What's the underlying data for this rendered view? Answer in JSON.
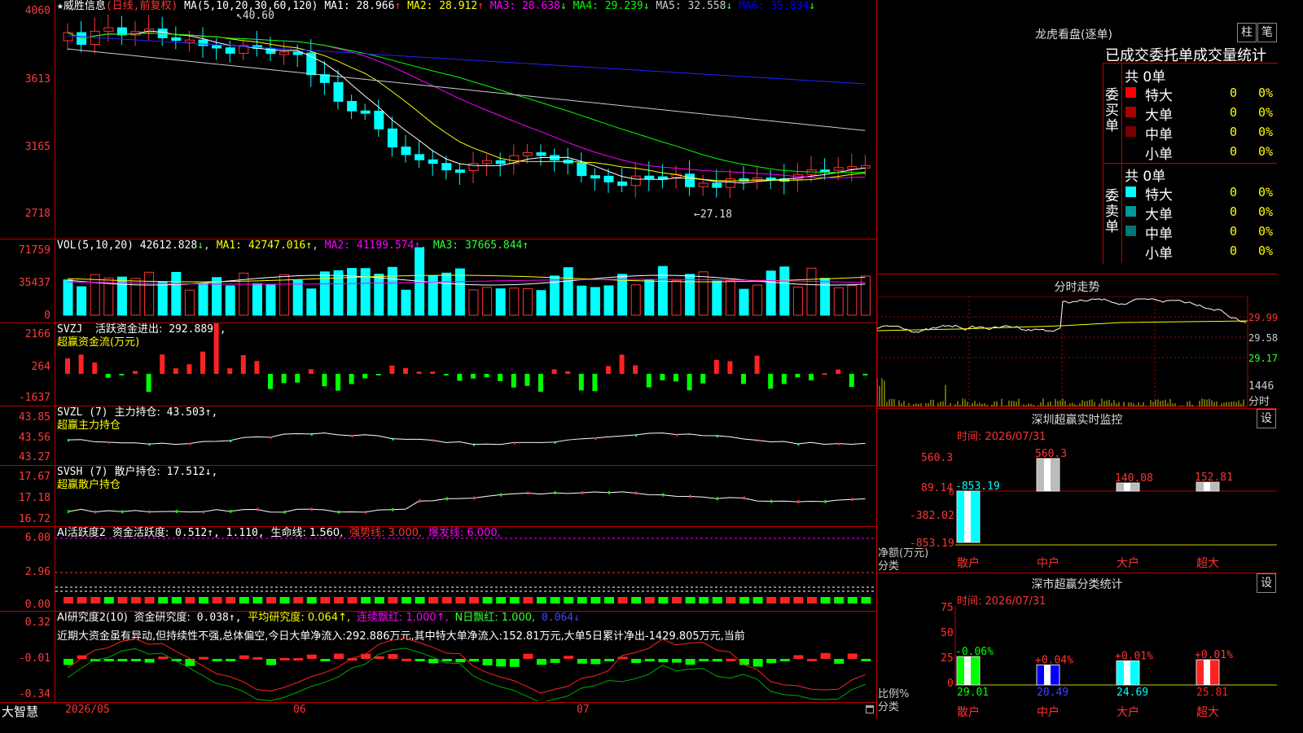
{
  "kline": {
    "title": "★威胜信息",
    "mode": "(日线,前复权)",
    "ma_label": "MA(5,10,20,30,60,120)",
    "ma": [
      {
        "name": "MA1",
        "value": "28.966",
        "arrow": "↑",
        "color": "#ffffff"
      },
      {
        "name": "MA2",
        "value": "28.912",
        "arrow": "↑",
        "color": "#ffff00"
      },
      {
        "name": "MA3",
        "value": "28.638",
        "arrow": "↓",
        "color": "#ff00ff"
      },
      {
        "name": "MA4",
        "value": "29.239",
        "arrow": "↓",
        "color": "#00ff00"
      },
      {
        "name": "MA5",
        "value": "32.558",
        "arrow": "↓",
        "color": "#cccccc"
      },
      {
        "name": "MA6",
        "value": "35.834",
        "arrow": "↓",
        "color": "#0000ff"
      }
    ],
    "y_ticks": [
      "4060",
      "3613",
      "3165",
      "2718"
    ],
    "high_marker": "40.60",
    "low_marker": "←27.18"
  },
  "vol": {
    "label": "VOL(5,10,20)",
    "value": "42612.828",
    "value_arrow": "↓",
    "ma1": "MA1: 42747.016↑",
    "ma2": "MA2: 41199.574↑",
    "ma3": "MA3: 37665.844↑",
    "y_ticks": [
      "71759",
      "35437",
      "0"
    ]
  },
  "svzj": {
    "label": "SVZJ",
    "name": "活跃资金进出:",
    "value": "292.889↑,",
    "subtitle": "超赢资金流(万元)",
    "y_ticks": [
      "2166",
      "264",
      "-1637"
    ]
  },
  "svzl": {
    "label": "SVZL (7)",
    "name": "主力持仓:",
    "value": "43.503↑,",
    "subtitle": "超赢主力持仓",
    "y_ticks": [
      "43.85",
      "43.56",
      "43.27"
    ]
  },
  "svsh": {
    "label": "SVSH (7)",
    "name": "散户持仓:",
    "value": "17.512↓,",
    "subtitle": "超赢散户持仓",
    "y_ticks": [
      "17.67",
      "17.18",
      "16.72"
    ]
  },
  "ai_active": {
    "label": "AI活跃度2",
    "name": "资金活跃度:",
    "value": "0.512↑,",
    "value2": "1.110,",
    "life": "生命线: 1.560,",
    "strong": "强势线: 3.000,",
    "burst": "爆发线: 6.000,",
    "y_ticks": [
      "6.00",
      "2.96",
      "0.00"
    ]
  },
  "ai_research": {
    "label": "AI研究度2(10)",
    "name": "资金研究度:",
    "value": "0.038↑,",
    "avg": "平均研究度: 0.064↑,",
    "cont": "连续飘红: 1.000↑,",
    "nday": "N日飘红: 1.000,",
    "last": "0.064↓",
    "comment": "近期大资金虽有异动,但持续性不强,总体偏空,今日大单净流入:292.886万元,其中特大单净流入:152.81万元,大单5日累计净出-1429.805万元,当前",
    "y_ticks": [
      "0.32",
      "-0.01",
      "-0.34"
    ]
  },
  "bottom": {
    "brand": "大智慧",
    "dates": [
      "2026/05",
      "06",
      "07"
    ]
  },
  "longhu": {
    "title": "龙虎看盘(逐单)",
    "btn1": "柱",
    "btn2": "笔",
    "subtitle": "已成交委托单成交量统计",
    "buy_label": "委买单",
    "sell_label": "委卖单",
    "buy_total": "共 0单",
    "sell_total": "共 0单",
    "buy_rows": [
      {
        "name": "特大",
        "count": "0",
        "pct": "0%",
        "color": "#ff0000"
      },
      {
        "name": "大单",
        "count": "0",
        "pct": "0%",
        "color": "#aa0000"
      },
      {
        "name": "中单",
        "count": "0",
        "pct": "0%",
        "color": "#770000"
      },
      {
        "name": "小单",
        "count": "0",
        "pct": "0%",
        "color": "#000000"
      }
    ],
    "sell_rows": [
      {
        "name": "特大",
        "count": "0",
        "pct": "0%",
        "color": "#00ffff"
      },
      {
        "name": "大单",
        "count": "0",
        "pct": "0%",
        "color": "#009999"
      },
      {
        "name": "中单",
        "count": "0",
        "pct": "0%",
        "color": "#007777"
      },
      {
        "name": "小单",
        "count": "0",
        "pct": "0%",
        "color": "#000000"
      }
    ]
  },
  "fenshi": {
    "title": "分时走势",
    "prices": [
      "29.99",
      "29.58",
      "29.17"
    ],
    "vol_label": "1446",
    "vol_unit": "分时"
  },
  "monitor": {
    "title": "深圳超赢实时监控",
    "btn": "设",
    "time": "时间: 2026/07/31",
    "y_ticks": [
      "560.3",
      "89.14",
      "-382.02",
      "-853.19"
    ],
    "side_top": "0",
    "ylabel": "净额(万元)",
    "xlabel": "分类",
    "categories": [
      "散户",
      "中户",
      "大户",
      "超大"
    ],
    "values": [
      "-853.19",
      "560.3",
      "140.08",
      "152.81"
    ]
  },
  "classify": {
    "title": "深市超赢分类统计",
    "btn": "设",
    "time": "时间: 2026/07/31",
    "y_ticks": [
      "75",
      "50",
      "25",
      "0"
    ],
    "ylabel": "比例%",
    "xlabel": "分类",
    "categories": [
      "散户",
      "中户",
      "大户",
      "超大"
    ],
    "changes": [
      "-0.06%",
      "+0.04%",
      "+0.01%",
      "+0.01%"
    ],
    "values": [
      "29.01",
      "20.49",
      "24.69",
      "25.81"
    ]
  }
}
